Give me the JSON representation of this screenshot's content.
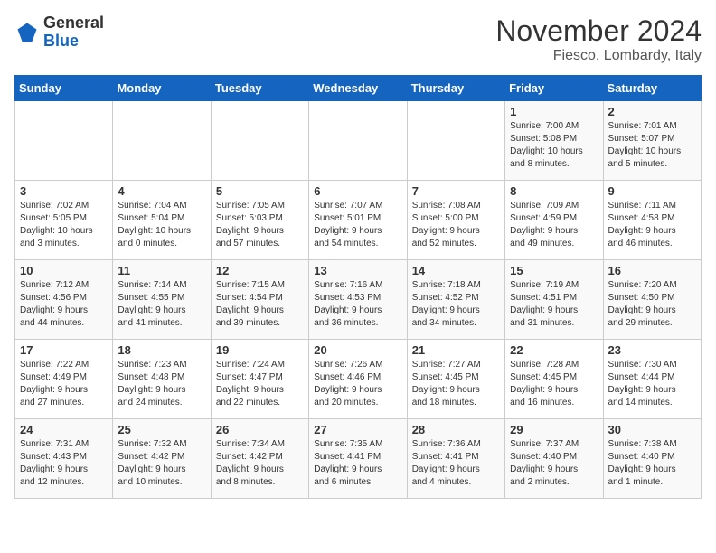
{
  "header": {
    "logo_line1": "General",
    "logo_line2": "Blue",
    "month_title": "November 2024",
    "subtitle": "Fiesco, Lombardy, Italy"
  },
  "days_of_week": [
    "Sunday",
    "Monday",
    "Tuesday",
    "Wednesday",
    "Thursday",
    "Friday",
    "Saturday"
  ],
  "weeks": [
    [
      {
        "num": "",
        "info": ""
      },
      {
        "num": "",
        "info": ""
      },
      {
        "num": "",
        "info": ""
      },
      {
        "num": "",
        "info": ""
      },
      {
        "num": "",
        "info": ""
      },
      {
        "num": "1",
        "info": "Sunrise: 7:00 AM\nSunset: 5:08 PM\nDaylight: 10 hours\nand 8 minutes."
      },
      {
        "num": "2",
        "info": "Sunrise: 7:01 AM\nSunset: 5:07 PM\nDaylight: 10 hours\nand 5 minutes."
      }
    ],
    [
      {
        "num": "3",
        "info": "Sunrise: 7:02 AM\nSunset: 5:05 PM\nDaylight: 10 hours\nand 3 minutes."
      },
      {
        "num": "4",
        "info": "Sunrise: 7:04 AM\nSunset: 5:04 PM\nDaylight: 10 hours\nand 0 minutes."
      },
      {
        "num": "5",
        "info": "Sunrise: 7:05 AM\nSunset: 5:03 PM\nDaylight: 9 hours\nand 57 minutes."
      },
      {
        "num": "6",
        "info": "Sunrise: 7:07 AM\nSunset: 5:01 PM\nDaylight: 9 hours\nand 54 minutes."
      },
      {
        "num": "7",
        "info": "Sunrise: 7:08 AM\nSunset: 5:00 PM\nDaylight: 9 hours\nand 52 minutes."
      },
      {
        "num": "8",
        "info": "Sunrise: 7:09 AM\nSunset: 4:59 PM\nDaylight: 9 hours\nand 49 minutes."
      },
      {
        "num": "9",
        "info": "Sunrise: 7:11 AM\nSunset: 4:58 PM\nDaylight: 9 hours\nand 46 minutes."
      }
    ],
    [
      {
        "num": "10",
        "info": "Sunrise: 7:12 AM\nSunset: 4:56 PM\nDaylight: 9 hours\nand 44 minutes."
      },
      {
        "num": "11",
        "info": "Sunrise: 7:14 AM\nSunset: 4:55 PM\nDaylight: 9 hours\nand 41 minutes."
      },
      {
        "num": "12",
        "info": "Sunrise: 7:15 AM\nSunset: 4:54 PM\nDaylight: 9 hours\nand 39 minutes."
      },
      {
        "num": "13",
        "info": "Sunrise: 7:16 AM\nSunset: 4:53 PM\nDaylight: 9 hours\nand 36 minutes."
      },
      {
        "num": "14",
        "info": "Sunrise: 7:18 AM\nSunset: 4:52 PM\nDaylight: 9 hours\nand 34 minutes."
      },
      {
        "num": "15",
        "info": "Sunrise: 7:19 AM\nSunset: 4:51 PM\nDaylight: 9 hours\nand 31 minutes."
      },
      {
        "num": "16",
        "info": "Sunrise: 7:20 AM\nSunset: 4:50 PM\nDaylight: 9 hours\nand 29 minutes."
      }
    ],
    [
      {
        "num": "17",
        "info": "Sunrise: 7:22 AM\nSunset: 4:49 PM\nDaylight: 9 hours\nand 27 minutes."
      },
      {
        "num": "18",
        "info": "Sunrise: 7:23 AM\nSunset: 4:48 PM\nDaylight: 9 hours\nand 24 minutes."
      },
      {
        "num": "19",
        "info": "Sunrise: 7:24 AM\nSunset: 4:47 PM\nDaylight: 9 hours\nand 22 minutes."
      },
      {
        "num": "20",
        "info": "Sunrise: 7:26 AM\nSunset: 4:46 PM\nDaylight: 9 hours\nand 20 minutes."
      },
      {
        "num": "21",
        "info": "Sunrise: 7:27 AM\nSunset: 4:45 PM\nDaylight: 9 hours\nand 18 minutes."
      },
      {
        "num": "22",
        "info": "Sunrise: 7:28 AM\nSunset: 4:45 PM\nDaylight: 9 hours\nand 16 minutes."
      },
      {
        "num": "23",
        "info": "Sunrise: 7:30 AM\nSunset: 4:44 PM\nDaylight: 9 hours\nand 14 minutes."
      }
    ],
    [
      {
        "num": "24",
        "info": "Sunrise: 7:31 AM\nSunset: 4:43 PM\nDaylight: 9 hours\nand 12 minutes."
      },
      {
        "num": "25",
        "info": "Sunrise: 7:32 AM\nSunset: 4:42 PM\nDaylight: 9 hours\nand 10 minutes."
      },
      {
        "num": "26",
        "info": "Sunrise: 7:34 AM\nSunset: 4:42 PM\nDaylight: 9 hours\nand 8 minutes."
      },
      {
        "num": "27",
        "info": "Sunrise: 7:35 AM\nSunset: 4:41 PM\nDaylight: 9 hours\nand 6 minutes."
      },
      {
        "num": "28",
        "info": "Sunrise: 7:36 AM\nSunset: 4:41 PM\nDaylight: 9 hours\nand 4 minutes."
      },
      {
        "num": "29",
        "info": "Sunrise: 7:37 AM\nSunset: 4:40 PM\nDaylight: 9 hours\nand 2 minutes."
      },
      {
        "num": "30",
        "info": "Sunrise: 7:38 AM\nSunset: 4:40 PM\nDaylight: 9 hours\nand 1 minute."
      }
    ]
  ]
}
